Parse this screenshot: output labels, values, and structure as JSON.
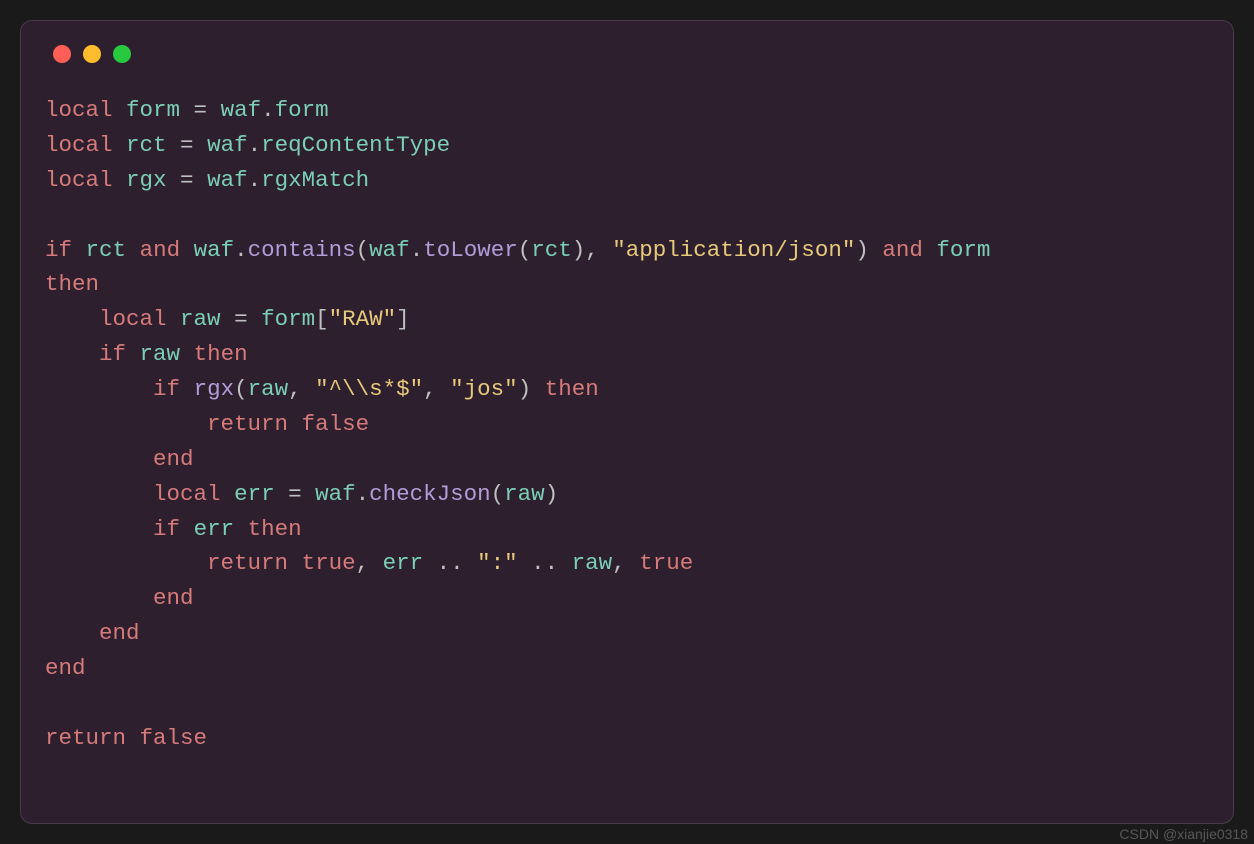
{
  "watermark": "CSDN @xianjie0318",
  "code": {
    "t": {
      "local": "local",
      "if": "if",
      "and": "and",
      "then": "then",
      "end": "end",
      "return": "return",
      "true": "true",
      "false": "false",
      "eq": " = ",
      "dot": ".",
      "comma": ", ",
      "lparen": "(",
      "rparen": ")",
      "lbrack": "[",
      "rbrack": "]",
      "concat": " .. "
    },
    "id": {
      "form": "form",
      "rct": "rct",
      "rgx": "rgx",
      "raw": "raw",
      "err": "err",
      "waf": "waf"
    },
    "member": {
      "form": "form",
      "reqContentType": "reqContentType",
      "rgxMatch": "rgxMatch",
      "contains": "contains",
      "toLower": "toLower",
      "checkJson": "checkJson"
    },
    "str": {
      "appjson": "\"application/json\"",
      "RAW": "\"RAW\"",
      "regex": "\"^\\\\s*$\"",
      "jos": "\"jos\"",
      "colon": "\":\""
    }
  }
}
